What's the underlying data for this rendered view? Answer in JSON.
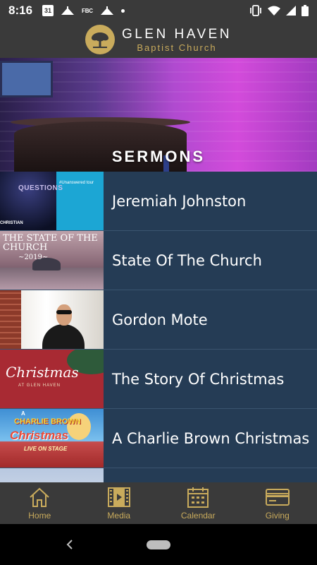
{
  "status_bar": {
    "time": "8:16",
    "calendar_day": "31",
    "fbc": "FBC"
  },
  "header": {
    "title": "GLEN HAVEN",
    "subtitle": "Baptist Church"
  },
  "banner": {
    "title": "SERMONS"
  },
  "sermons": [
    {
      "title": "Jeremiah Johnston",
      "thumb_text": [
        "QUESTIONS",
        "#Unanswered tour",
        "CHRISTIAN"
      ]
    },
    {
      "title": "State Of The Church",
      "thumb_text": [
        "THE STATE OF THE CHURCH",
        "~2019~"
      ]
    },
    {
      "title": "Gordon Mote",
      "thumb_text": []
    },
    {
      "title": "The Story Of Christmas",
      "thumb_text": [
        "Christmas",
        "AT GLEN HAVEN"
      ]
    },
    {
      "title": "A Charlie Brown Christmas",
      "thumb_text": [
        "A",
        "CHARLIE BROWN",
        "Christmas",
        "LIVE ON STAGE"
      ]
    }
  ],
  "bottom_nav": [
    {
      "label": "Home",
      "icon": "home-icon"
    },
    {
      "label": "Media",
      "icon": "film-icon"
    },
    {
      "label": "Calendar",
      "icon": "calendar-icon"
    },
    {
      "label": "Giving",
      "icon": "card-icon"
    }
  ],
  "colors": {
    "accent_gold": "#c9ab5c",
    "list_bg": "#253c55",
    "bar_bg": "#3a3a3a"
  }
}
